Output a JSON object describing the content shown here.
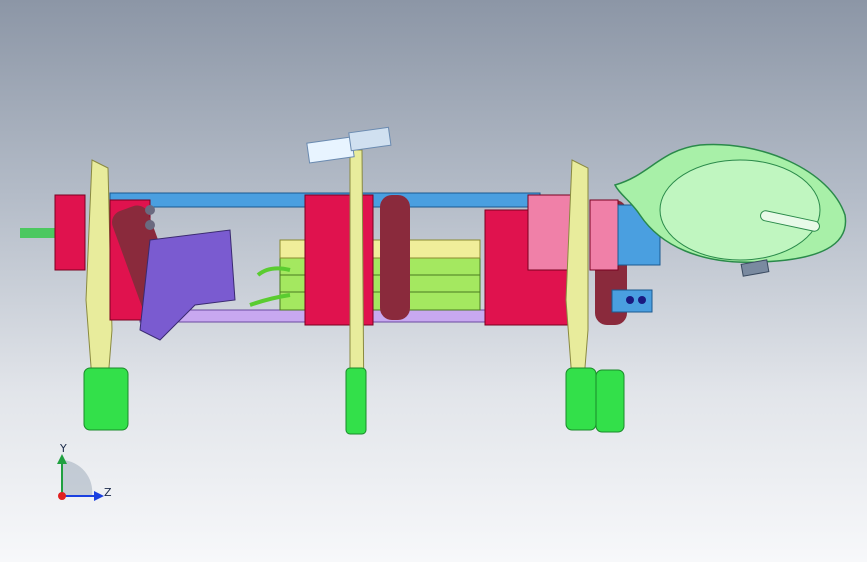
{
  "viewport": {
    "background_top": "#8c96a6",
    "background_bottom": "#f7f8fa"
  },
  "model": {
    "description_colors": {
      "frame_blue": "#4a9fe0",
      "servo_red": "#e0124e",
      "leg_yellow": "#e8ec9c",
      "foot_green": "#33e04a",
      "bracket_purple": "#7a5bd0",
      "battery_green": "#a4e860",
      "head_green": "#a8f0a8",
      "link_maroon": "#8a2a3c"
    }
  },
  "triad": {
    "y_label": "Y",
    "z_label": "Z",
    "icon": "coordinate-triad-icon"
  }
}
